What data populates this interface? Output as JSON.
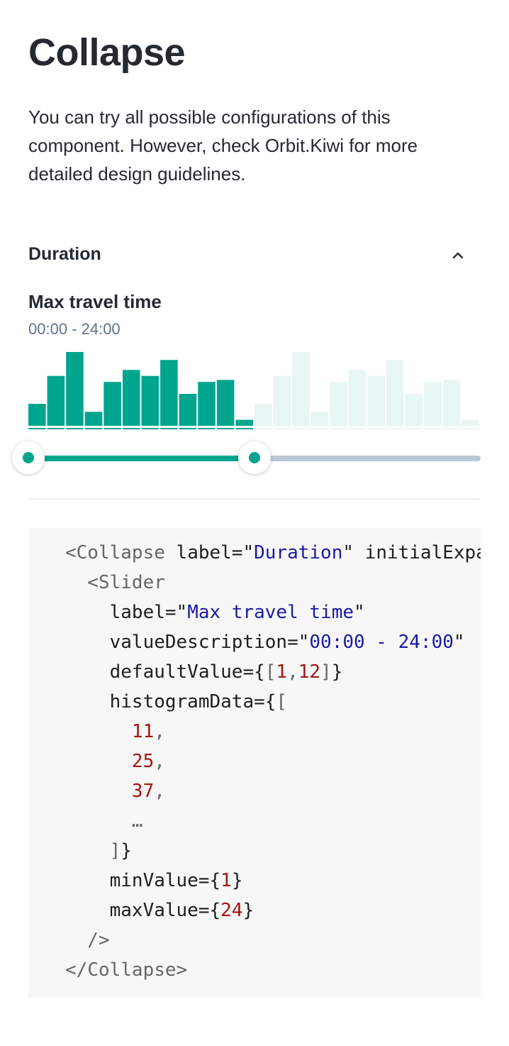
{
  "page": {
    "title": "Collapse",
    "intro": "You can try all possible configurations of this component. However, check Orbit.Kiwi for more detailed design guidelines."
  },
  "collapse": {
    "label": "Duration",
    "expanded": true,
    "chevron_icon": "chevron-up-icon"
  },
  "slider": {
    "label": "Max travel time",
    "value_description": "00:00 - 24:00",
    "min": 1,
    "max": 24,
    "selected_range": [
      1,
      12
    ],
    "histogram": [
      11,
      25,
      37,
      7,
      22,
      28,
      25,
      33,
      16,
      22,
      23,
      3,
      11,
      25,
      37,
      7,
      22,
      28,
      25,
      33,
      16,
      22,
      23,
      3
    ],
    "colors": {
      "active": "#00a58e",
      "inactive": "#e8f6f4",
      "track": "#bac7d5"
    }
  },
  "code": {
    "lines": [
      [
        [
          "<",
          "punc"
        ],
        [
          "Collapse",
          "punc"
        ],
        [
          " label=",
          "attr"
        ],
        [
          "\"",
          "attr"
        ],
        [
          "Duration",
          "str"
        ],
        [
          "\"",
          "attr"
        ],
        [
          " initialExpanded",
          "attr"
        ]
      ],
      [
        [
          "  <",
          "punc"
        ],
        [
          "Slider",
          "punc"
        ]
      ],
      [
        [
          "    label=",
          "attr"
        ],
        [
          "\"",
          "attr"
        ],
        [
          "Max travel time",
          "str"
        ],
        [
          "\"",
          "attr"
        ]
      ],
      [
        [
          "    valueDescription=",
          "attr"
        ],
        [
          "\"",
          "attr"
        ],
        [
          "00:00 - 24:00",
          "str"
        ],
        [
          "\"",
          "attr"
        ]
      ],
      [
        [
          "    defaultValue=",
          "attr"
        ],
        [
          "{",
          "attr"
        ],
        [
          "[",
          "punc"
        ],
        [
          "1",
          "num"
        ],
        [
          ",",
          "punc"
        ],
        [
          "12",
          "num"
        ],
        [
          "]",
          "punc"
        ],
        [
          "}",
          "attr"
        ]
      ],
      [
        [
          "    histogramData=",
          "attr"
        ],
        [
          "{",
          "attr"
        ],
        [
          "[",
          "punc"
        ]
      ],
      [
        [
          "      ",
          "attr"
        ],
        [
          "11",
          "num"
        ],
        [
          ",",
          "punc"
        ]
      ],
      [
        [
          "      ",
          "attr"
        ],
        [
          "25",
          "num"
        ],
        [
          ",",
          "punc"
        ]
      ],
      [
        [
          "      ",
          "attr"
        ],
        [
          "37",
          "num"
        ],
        [
          ",",
          "punc"
        ]
      ],
      [
        [
          "      …",
          "punc"
        ]
      ],
      [
        [
          "    ]",
          "punc"
        ],
        [
          "}",
          "attr"
        ]
      ],
      [
        [
          "    minValue=",
          "attr"
        ],
        [
          "{",
          "attr"
        ],
        [
          "1",
          "num"
        ],
        [
          "}",
          "attr"
        ]
      ],
      [
        [
          "    maxValue=",
          "attr"
        ],
        [
          "{",
          "attr"
        ],
        [
          "24",
          "num"
        ],
        [
          "}",
          "attr"
        ]
      ],
      [
        [
          "  />",
          "punc"
        ]
      ],
      [
        [
          "</",
          "punc"
        ],
        [
          "Collapse",
          "punc"
        ],
        [
          ">",
          "punc"
        ]
      ]
    ]
  }
}
